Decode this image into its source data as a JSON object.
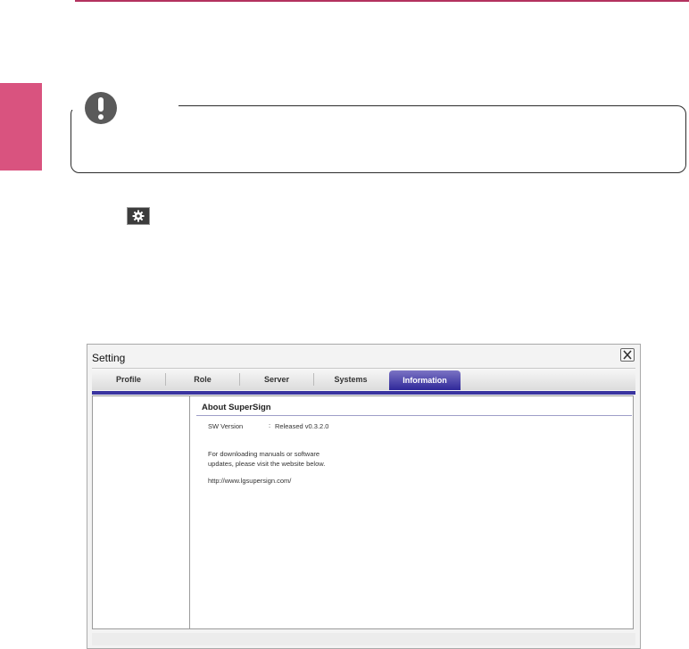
{
  "setting_window": {
    "title": "Setting",
    "tabs": [
      "Profile",
      "Role",
      "Server",
      "Systems",
      "Information"
    ],
    "active_tab": "Information",
    "about": {
      "heading": "About SuperSign",
      "sw_version_label": "SW Version",
      "separator": ":",
      "sw_version_value": "Released v0.3.2.0",
      "help_line1": "For downloading manuals or software",
      "help_line2": "updates, please visit the website below.",
      "url": "http://www.lgsupersign.com/"
    }
  },
  "colors": {
    "header_rule": "#b3325f",
    "side_tab": "#d9537f",
    "active_tab": "#2f2899",
    "note_icon": "#5a5a5a"
  },
  "icons": [
    "note-exclamation-icon",
    "gear-icon",
    "close-icon"
  ]
}
